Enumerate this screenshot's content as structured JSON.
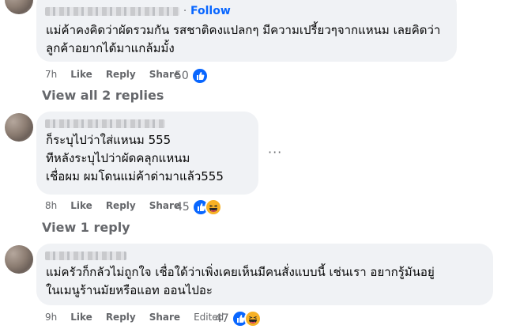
{
  "comments": [
    {
      "follow_label": "Follow",
      "separator": "·",
      "text": "แม่ค้าคงคิดว่าผัดรวมกัน รสชาติคงแปลกๆ มีความเปรี้ยวๆจากแหนม เลยคิดว่า\nลูกค้าอยากได้มาแกล้มมั้ง",
      "time": "7h",
      "like_label": "Like",
      "reply_label": "Reply",
      "share_label": "Share",
      "reaction_count": "50",
      "reactions": [
        "like-icon"
      ]
    },
    {
      "text": "ก็ระบุไปว่าใส่แหนม 555\nทีหลังระบุไปว่าผัดคลุกแหนม\nเชื่อผม ผมโดนแม่ค้าด่ามาแล้ว555",
      "more_label": "···",
      "time": "8h",
      "like_label": "Like",
      "reply_label": "Reply",
      "share_label": "Share",
      "reaction_count": "45",
      "reactions": [
        "like-icon",
        "haha-icon"
      ]
    },
    {
      "text": "แม่ครัวก็กลัวไม่ถูกใจ เชื่อใด้ว่าเพิ่งเคยเห็นมีคนสั่งแบบนี้ เช่นเรา อยากรู้มันอยู่\nในเมนูร้านมัยหรือแอท ออนไปอะ",
      "time": "9h",
      "like_label": "Like",
      "reply_label": "Reply",
      "share_label": "Share",
      "edited_label": "Edited",
      "reaction_count": "47",
      "reactions": [
        "like-icon",
        "haha-icon"
      ]
    }
  ],
  "view_replies_1": "View all 2 replies",
  "view_replies_2": "View 1 reply",
  "colors": {
    "link": "#0866ff",
    "bubble": "#f0f2f5",
    "meta": "#65676b",
    "haha": "#f7b125"
  }
}
